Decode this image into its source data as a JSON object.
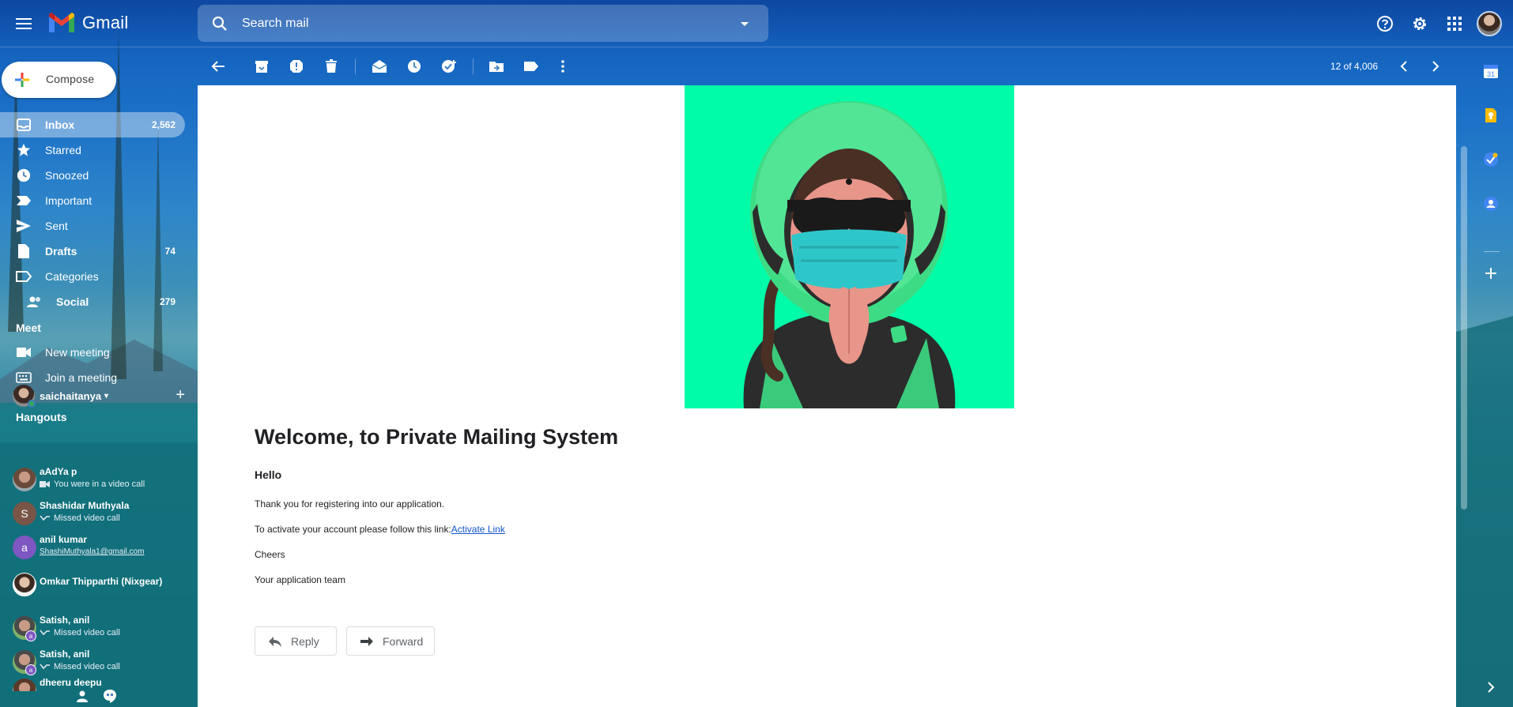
{
  "app": {
    "name": "Gmail"
  },
  "search": {
    "placeholder": "Search mail"
  },
  "sidebar": {
    "compose_label": "Compose",
    "items": [
      {
        "label": "Inbox",
        "count": "2,562",
        "icon": "inbox-icon"
      },
      {
        "label": "Starred",
        "count": "",
        "icon": "star-icon"
      },
      {
        "label": "Snoozed",
        "count": "",
        "icon": "clock-icon"
      },
      {
        "label": "Important",
        "count": "",
        "icon": "important-icon"
      },
      {
        "label": "Sent",
        "count": "",
        "icon": "send-icon"
      },
      {
        "label": "Drafts",
        "count": "74",
        "icon": "draft-icon"
      },
      {
        "label": "Categories",
        "count": "",
        "icon": "label-icon"
      },
      {
        "label": "Social",
        "count": "279",
        "icon": "people-icon"
      }
    ],
    "meet": {
      "title": "Meet",
      "new_meeting": "New meeting",
      "join_meeting": "Join a meeting"
    },
    "hangouts": {
      "title": "Hangouts",
      "user": "saichaitanya",
      "contacts": [
        {
          "name": "aAdYa p",
          "status": "You were in a video call",
          "initial": ""
        },
        {
          "name": "Shashidar Muthyala",
          "status": "Missed video call",
          "initial": "S"
        },
        {
          "name": "anil kumar",
          "status": "ShashiMuthyala1@gmail.com",
          "initial": "a"
        },
        {
          "name": "Omkar Thipparthi (Nixgear)",
          "status": "",
          "initial": ""
        },
        {
          "name": "Satish, anil",
          "status": "Missed video call",
          "initial": ""
        },
        {
          "name": "Satish, anil",
          "status": "Missed video call",
          "initial": ""
        },
        {
          "name": "dheeru deepu",
          "status": "",
          "initial": ""
        }
      ]
    }
  },
  "toolbar": {
    "pager": "12 of 4,006"
  },
  "message": {
    "title": "Welcome, to Private Mailing System",
    "greeting": "Hello",
    "line1": "Thank you for registering into our application.",
    "line2": "To activate your account please follow this link:",
    "link_text": "Activate Link",
    "line3": "Cheers",
    "line4": "Your application team",
    "reply_label": "Reply",
    "forward_label": "Forward"
  },
  "colors": {
    "hero_bg": "#00fca8",
    "helmet_green": "#3ddc84",
    "mask": "#2ec7c9",
    "link": "#1155cc",
    "inbox_active": "rgba(255,255,255,0.4)"
  }
}
